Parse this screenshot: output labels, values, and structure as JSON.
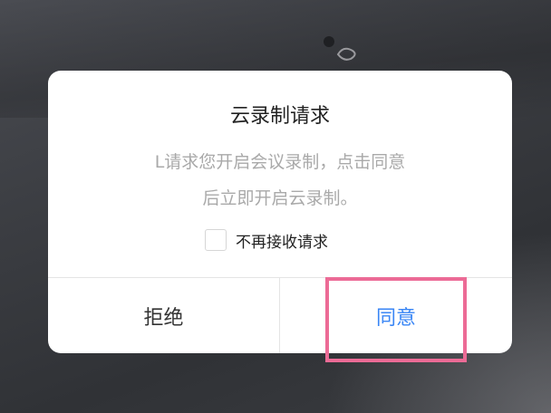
{
  "dialog": {
    "title": "云录制请求",
    "message_line1": "L请求您开启会议录制，点击同意",
    "message_line2": "后立即开启云录制。",
    "checkbox_label": "不再接收请求",
    "reject_label": "拒绝",
    "agree_label": "同意"
  },
  "colors": {
    "agree_text": "#3a86f5",
    "highlight_border": "#ec6b96",
    "message_text": "#a9a9a9"
  }
}
